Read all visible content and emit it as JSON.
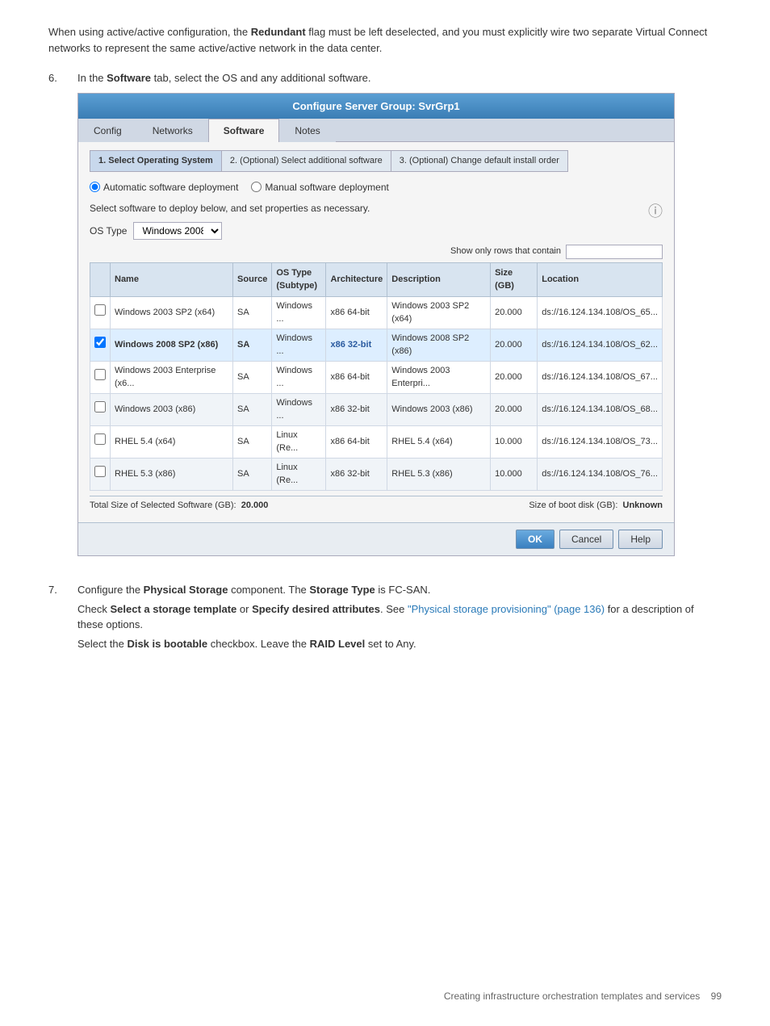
{
  "intro": {
    "text1": "When using active/active configuration, the ",
    "bold1": "Redundant",
    "text2": " flag must be left deselected, and you must explicitly wire two separate Virtual Connect networks to represent the same active/active network in the data center."
  },
  "step6": {
    "num": "6.",
    "text1": "In the ",
    "bold1": "Software",
    "text2": " tab, select the OS and any additional software."
  },
  "dialog": {
    "title": "Configure Server Group: SvrGrp1",
    "tabs": [
      {
        "label": "Config",
        "active": false
      },
      {
        "label": "Networks",
        "active": false
      },
      {
        "label": "Software",
        "active": true
      },
      {
        "label": "Notes",
        "active": false
      }
    ],
    "wizard_steps": [
      {
        "label": "1. Select Operating System",
        "active": true
      },
      {
        "label": "2. (Optional) Select additional software",
        "active": false
      },
      {
        "label": "3. (Optional) Change default install order",
        "active": false
      }
    ],
    "deployment": {
      "auto_label": "Automatic software deployment",
      "manual_label": "Manual software deployment"
    },
    "select_label": "Select software to deploy below, and set properties as necessary.",
    "os_type_label": "OS Type",
    "os_type_value": "Windows 2008",
    "filter_label": "Show only rows that contain",
    "columns": [
      "Name",
      "Source",
      "OS Type\n(Subtype)",
      "Architecture",
      "Description",
      "Size (GB)",
      "Location"
    ],
    "rows": [
      {
        "checked": false,
        "name": "Windows 2003 SP2 (x64)",
        "source": "SA",
        "os_type": "Windows ...",
        "arch": "x86 64-bit",
        "desc": "Windows 2003 SP2 (x64)",
        "size": "20.000",
        "location": "ds://16.124.134.108/OS_65...",
        "highlighted": false
      },
      {
        "checked": true,
        "name": "Windows 2008 SP2 (x86)",
        "source": "SA",
        "os_type": "Windows ...",
        "arch": "x86 32-bit",
        "desc": "Windows 2008 SP2 (x86)",
        "size": "20.000",
        "location": "ds://16.124.134.108/OS_62...",
        "highlighted": true
      },
      {
        "checked": false,
        "name": "Windows 2003 Enterprise (x6...",
        "source": "SA",
        "os_type": "Windows ...",
        "arch": "x86 64-bit",
        "desc": "Windows 2003 Enterpri...",
        "size": "20.000",
        "location": "ds://16.124.134.108/OS_67...",
        "highlighted": false
      },
      {
        "checked": false,
        "name": "Windows 2003 (x86)",
        "source": "SA",
        "os_type": "Windows ...",
        "arch": "x86 32-bit",
        "desc": "Windows 2003 (x86)",
        "size": "20.000",
        "location": "ds://16.124.134.108/OS_68...",
        "highlighted": false
      },
      {
        "checked": false,
        "name": "RHEL 5.4 (x64)",
        "source": "SA",
        "os_type": "Linux (Re...",
        "arch": "x86 64-bit",
        "desc": "RHEL 5.4 (x64)",
        "size": "10.000",
        "location": "ds://16.124.134.108/OS_73...",
        "highlighted": false
      },
      {
        "checked": false,
        "name": "RHEL 5.3 (x86)",
        "source": "SA",
        "os_type": "Linux (Re...",
        "arch": "x86 32-bit",
        "desc": "RHEL 5.3 (x86)",
        "size": "10.000",
        "location": "ds://16.124.134.108/OS_76...",
        "highlighted": false
      }
    ],
    "total_label": "Total Size of Selected Software (GB):",
    "total_value": "20.000",
    "boot_label": "Size of boot disk (GB):",
    "boot_value": "Unknown",
    "buttons": {
      "ok": "OK",
      "cancel": "Cancel",
      "help": "Help"
    }
  },
  "step7": {
    "num": "7.",
    "text1": "Configure the ",
    "bold1": "Physical Storage",
    "text2": " component. The ",
    "bold2": "Storage Type",
    "text3": " is FC-SAN.",
    "line2_text1": "Check ",
    "bold3": "Select a storage template",
    "line2_text2": " or ",
    "bold4": "Specify desired attributes",
    "line2_text3": ". See ",
    "link_text": "\"Physical storage provisioning\" (page 136)",
    "line2_text4": " for a description of these options.",
    "line3_text1": "Select the ",
    "bold5": "Disk is bootable",
    "line3_text2": " checkbox. Leave the ",
    "bold6": "RAID Level",
    "line3_text3": " set to Any."
  },
  "footer": {
    "text": "Creating infrastructure orchestration templates and services",
    "page": "99"
  }
}
